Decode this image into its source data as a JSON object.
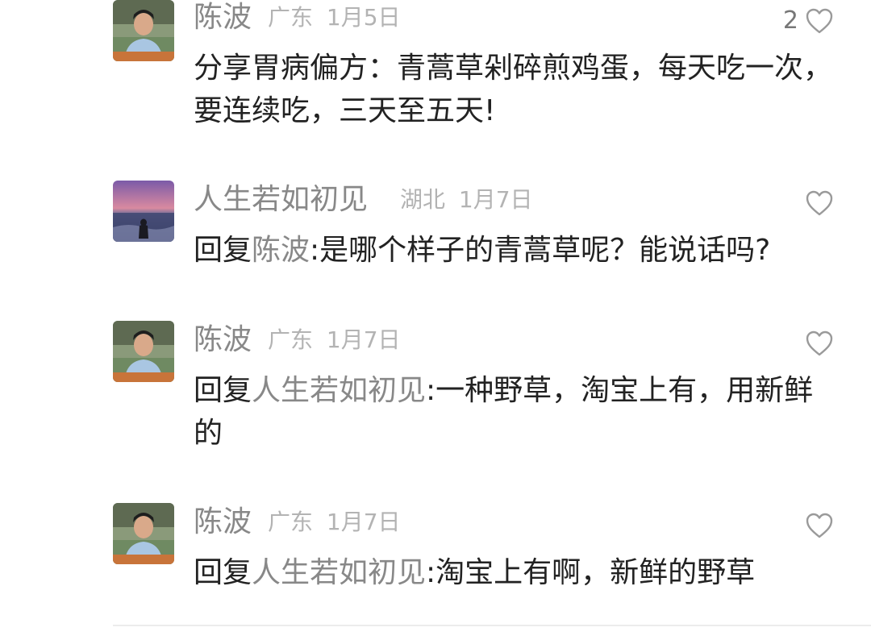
{
  "comments": [
    {
      "avatar": "man-avatar",
      "name": "陈波",
      "region": "广东",
      "date": "1月5日",
      "likes": "2",
      "reply_prefix": "",
      "mention": "",
      "text": "分享胃病偏方：青蒿草剁碎煎鸡蛋，每天吃一次，要连续吃，三天至五天!"
    },
    {
      "avatar": "sunset-beach-avatar",
      "name": "人生若如初见",
      "region": "湖北",
      "date": "1月7日",
      "likes": "",
      "reply_prefix": "回复",
      "mention": "陈波",
      "text": ":是哪个样子的青蒿草呢？能说话吗?"
    },
    {
      "avatar": "man-avatar",
      "name": "陈波",
      "region": "广东",
      "date": "1月7日",
      "likes": "",
      "reply_prefix": "回复",
      "mention": "人生若如初见",
      "text": ":一种野草，淘宝上有，用新鲜的"
    },
    {
      "avatar": "man-avatar",
      "name": "陈波",
      "region": "广东",
      "date": "1月7日",
      "likes": "",
      "reply_prefix": "回复",
      "mention": "人生若如初见",
      "text": ":淘宝上有啊，新鲜的野草"
    }
  ],
  "colors": {
    "name": "#888888",
    "meta": "#b3b3b3",
    "text": "#222222",
    "mention": "#888888",
    "icon": "#9a9a9a"
  }
}
